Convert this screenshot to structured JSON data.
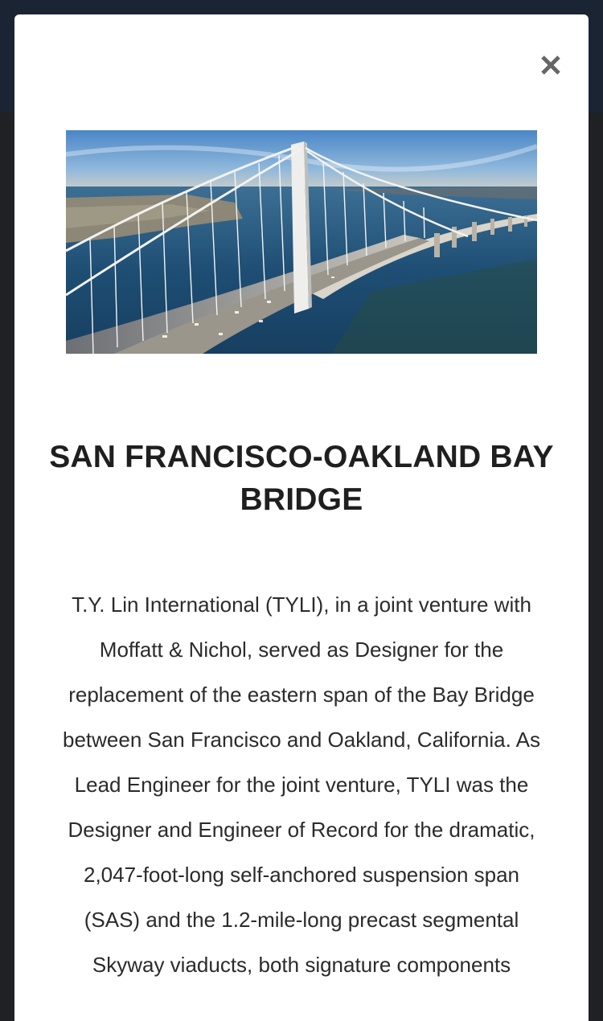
{
  "modal": {
    "close_icon": "close-icon",
    "image": {
      "alt": "San Francisco-Oakland Bay Bridge self-anchored suspension span aerial view"
    },
    "title": "SAN FRANCISCO-OAKLAND BAY BRIDGE",
    "description": "T.Y. Lin International (TYLI), in a joint venture with Moffatt & Nichol, served as Designer for the replacement of the eastern span of the Bay Bridge between San Francisco and Oakland, California. As Lead Engineer for the joint venture, TYLI was the Designer and Engineer of Record for the dramatic, 2,047-foot-long self-anchored suspension span (SAS) and the 1.2-mile-long precast segmental Skyway viaducts, both signature components"
  },
  "colors": {
    "backdrop": "#202124",
    "modal_bg": "#ffffff",
    "title": "#1f1f1f",
    "text": "#2b2b2b",
    "close_icon": "#666666"
  }
}
